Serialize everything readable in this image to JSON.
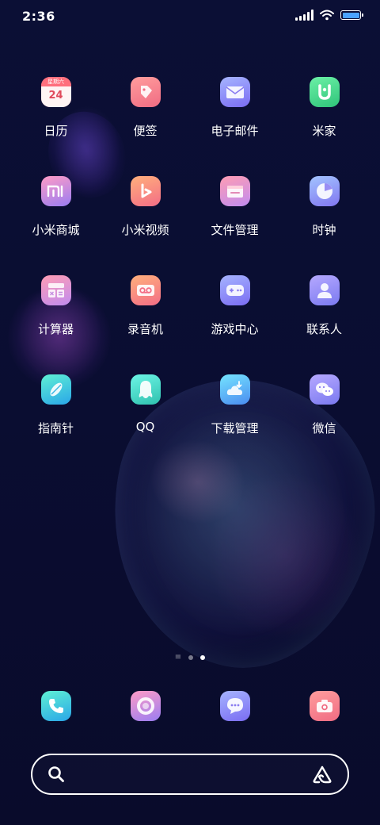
{
  "status_bar": {
    "time": "2:36",
    "battery_level": 1.0,
    "battery_color": "#4aa3ff"
  },
  "apps": [
    {
      "label": "日历",
      "icon": "calendar-icon",
      "calendar_weekday": "星期六",
      "calendar_day": "24"
    },
    {
      "label": "便签",
      "icon": "notes-icon"
    },
    {
      "label": "电子邮件",
      "icon": "email-icon"
    },
    {
      "label": "米家",
      "icon": "mijia-icon"
    },
    {
      "label": "小米商城",
      "icon": "mi-store-icon"
    },
    {
      "label": "小米视频",
      "icon": "mi-video-icon"
    },
    {
      "label": "文件管理",
      "icon": "file-manager-icon"
    },
    {
      "label": "时钟",
      "icon": "clock-icon"
    },
    {
      "label": "计算器",
      "icon": "calculator-icon"
    },
    {
      "label": "录音机",
      "icon": "recorder-icon"
    },
    {
      "label": "游戏中心",
      "icon": "game-center-icon"
    },
    {
      "label": "联系人",
      "icon": "contacts-icon"
    },
    {
      "label": "指南针",
      "icon": "compass-icon"
    },
    {
      "label": "QQ",
      "icon": "qq-icon"
    },
    {
      "label": "下载管理",
      "icon": "download-manager-icon"
    },
    {
      "label": "微信",
      "icon": "wechat-icon"
    }
  ],
  "page_indicator": {
    "pages": 3,
    "current": 3
  },
  "dock": [
    {
      "icon": "phone-icon"
    },
    {
      "icon": "security-icon"
    },
    {
      "icon": "messages-icon"
    },
    {
      "icon": "camera-icon"
    }
  ],
  "search_bar": {
    "left_icon": "search-icon",
    "right_icon": "assistant-icon"
  }
}
